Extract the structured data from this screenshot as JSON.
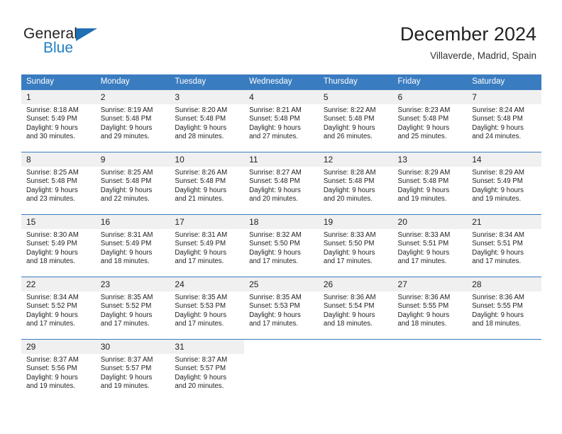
{
  "brand": {
    "name_top": "General",
    "name_bottom": "Blue",
    "triangle_icon": "triangle-icon",
    "color_dark": "#231f20",
    "color_blue": "#1f7ec4"
  },
  "header": {
    "title": "December 2024",
    "subtitle": "Villaverde, Madrid, Spain"
  },
  "theme": {
    "header_bar": "#3a7cc0",
    "daynum_band": "#f0f0f0",
    "text": "#222222"
  },
  "calendar": {
    "weekday_headers": [
      "Sunday",
      "Monday",
      "Tuesday",
      "Wednesday",
      "Thursday",
      "Friday",
      "Saturday"
    ],
    "weeks": [
      [
        {
          "day": "1",
          "sunrise": "Sunrise: 8:18 AM",
          "sunset": "Sunset: 5:49 PM",
          "daylight_1": "Daylight: 9 hours",
          "daylight_2": "and 30 minutes."
        },
        {
          "day": "2",
          "sunrise": "Sunrise: 8:19 AM",
          "sunset": "Sunset: 5:48 PM",
          "daylight_1": "Daylight: 9 hours",
          "daylight_2": "and 29 minutes."
        },
        {
          "day": "3",
          "sunrise": "Sunrise: 8:20 AM",
          "sunset": "Sunset: 5:48 PM",
          "daylight_1": "Daylight: 9 hours",
          "daylight_2": "and 28 minutes."
        },
        {
          "day": "4",
          "sunrise": "Sunrise: 8:21 AM",
          "sunset": "Sunset: 5:48 PM",
          "daylight_1": "Daylight: 9 hours",
          "daylight_2": "and 27 minutes."
        },
        {
          "day": "5",
          "sunrise": "Sunrise: 8:22 AM",
          "sunset": "Sunset: 5:48 PM",
          "daylight_1": "Daylight: 9 hours",
          "daylight_2": "and 26 minutes."
        },
        {
          "day": "6",
          "sunrise": "Sunrise: 8:23 AM",
          "sunset": "Sunset: 5:48 PM",
          "daylight_1": "Daylight: 9 hours",
          "daylight_2": "and 25 minutes."
        },
        {
          "day": "7",
          "sunrise": "Sunrise: 8:24 AM",
          "sunset": "Sunset: 5:48 PM",
          "daylight_1": "Daylight: 9 hours",
          "daylight_2": "and 24 minutes."
        }
      ],
      [
        {
          "day": "8",
          "sunrise": "Sunrise: 8:25 AM",
          "sunset": "Sunset: 5:48 PM",
          "daylight_1": "Daylight: 9 hours",
          "daylight_2": "and 23 minutes."
        },
        {
          "day": "9",
          "sunrise": "Sunrise: 8:25 AM",
          "sunset": "Sunset: 5:48 PM",
          "daylight_1": "Daylight: 9 hours",
          "daylight_2": "and 22 minutes."
        },
        {
          "day": "10",
          "sunrise": "Sunrise: 8:26 AM",
          "sunset": "Sunset: 5:48 PM",
          "daylight_1": "Daylight: 9 hours",
          "daylight_2": "and 21 minutes."
        },
        {
          "day": "11",
          "sunrise": "Sunrise: 8:27 AM",
          "sunset": "Sunset: 5:48 PM",
          "daylight_1": "Daylight: 9 hours",
          "daylight_2": "and 20 minutes."
        },
        {
          "day": "12",
          "sunrise": "Sunrise: 8:28 AM",
          "sunset": "Sunset: 5:48 PM",
          "daylight_1": "Daylight: 9 hours",
          "daylight_2": "and 20 minutes."
        },
        {
          "day": "13",
          "sunrise": "Sunrise: 8:29 AM",
          "sunset": "Sunset: 5:48 PM",
          "daylight_1": "Daylight: 9 hours",
          "daylight_2": "and 19 minutes."
        },
        {
          "day": "14",
          "sunrise": "Sunrise: 8:29 AM",
          "sunset": "Sunset: 5:49 PM",
          "daylight_1": "Daylight: 9 hours",
          "daylight_2": "and 19 minutes."
        }
      ],
      [
        {
          "day": "15",
          "sunrise": "Sunrise: 8:30 AM",
          "sunset": "Sunset: 5:49 PM",
          "daylight_1": "Daylight: 9 hours",
          "daylight_2": "and 18 minutes."
        },
        {
          "day": "16",
          "sunrise": "Sunrise: 8:31 AM",
          "sunset": "Sunset: 5:49 PM",
          "daylight_1": "Daylight: 9 hours",
          "daylight_2": "and 18 minutes."
        },
        {
          "day": "17",
          "sunrise": "Sunrise: 8:31 AM",
          "sunset": "Sunset: 5:49 PM",
          "daylight_1": "Daylight: 9 hours",
          "daylight_2": "and 17 minutes."
        },
        {
          "day": "18",
          "sunrise": "Sunrise: 8:32 AM",
          "sunset": "Sunset: 5:50 PM",
          "daylight_1": "Daylight: 9 hours",
          "daylight_2": "and 17 minutes."
        },
        {
          "day": "19",
          "sunrise": "Sunrise: 8:33 AM",
          "sunset": "Sunset: 5:50 PM",
          "daylight_1": "Daylight: 9 hours",
          "daylight_2": "and 17 minutes."
        },
        {
          "day": "20",
          "sunrise": "Sunrise: 8:33 AM",
          "sunset": "Sunset: 5:51 PM",
          "daylight_1": "Daylight: 9 hours",
          "daylight_2": "and 17 minutes."
        },
        {
          "day": "21",
          "sunrise": "Sunrise: 8:34 AM",
          "sunset": "Sunset: 5:51 PM",
          "daylight_1": "Daylight: 9 hours",
          "daylight_2": "and 17 minutes."
        }
      ],
      [
        {
          "day": "22",
          "sunrise": "Sunrise: 8:34 AM",
          "sunset": "Sunset: 5:52 PM",
          "daylight_1": "Daylight: 9 hours",
          "daylight_2": "and 17 minutes."
        },
        {
          "day": "23",
          "sunrise": "Sunrise: 8:35 AM",
          "sunset": "Sunset: 5:52 PM",
          "daylight_1": "Daylight: 9 hours",
          "daylight_2": "and 17 minutes."
        },
        {
          "day": "24",
          "sunrise": "Sunrise: 8:35 AM",
          "sunset": "Sunset: 5:53 PM",
          "daylight_1": "Daylight: 9 hours",
          "daylight_2": "and 17 minutes."
        },
        {
          "day": "25",
          "sunrise": "Sunrise: 8:35 AM",
          "sunset": "Sunset: 5:53 PM",
          "daylight_1": "Daylight: 9 hours",
          "daylight_2": "and 17 minutes."
        },
        {
          "day": "26",
          "sunrise": "Sunrise: 8:36 AM",
          "sunset": "Sunset: 5:54 PM",
          "daylight_1": "Daylight: 9 hours",
          "daylight_2": "and 18 minutes."
        },
        {
          "day": "27",
          "sunrise": "Sunrise: 8:36 AM",
          "sunset": "Sunset: 5:55 PM",
          "daylight_1": "Daylight: 9 hours",
          "daylight_2": "and 18 minutes."
        },
        {
          "day": "28",
          "sunrise": "Sunrise: 8:36 AM",
          "sunset": "Sunset: 5:55 PM",
          "daylight_1": "Daylight: 9 hours",
          "daylight_2": "and 18 minutes."
        }
      ],
      [
        {
          "day": "29",
          "sunrise": "Sunrise: 8:37 AM",
          "sunset": "Sunset: 5:56 PM",
          "daylight_1": "Daylight: 9 hours",
          "daylight_2": "and 19 minutes."
        },
        {
          "day": "30",
          "sunrise": "Sunrise: 8:37 AM",
          "sunset": "Sunset: 5:57 PM",
          "daylight_1": "Daylight: 9 hours",
          "daylight_2": "and 19 minutes."
        },
        {
          "day": "31",
          "sunrise": "Sunrise: 8:37 AM",
          "sunset": "Sunset: 5:57 PM",
          "daylight_1": "Daylight: 9 hours",
          "daylight_2": "and 20 minutes."
        },
        {
          "day": "",
          "sunrise": "",
          "sunset": "",
          "daylight_1": "",
          "daylight_2": ""
        },
        {
          "day": "",
          "sunrise": "",
          "sunset": "",
          "daylight_1": "",
          "daylight_2": ""
        },
        {
          "day": "",
          "sunrise": "",
          "sunset": "",
          "daylight_1": "",
          "daylight_2": ""
        },
        {
          "day": "",
          "sunrise": "",
          "sunset": "",
          "daylight_1": "",
          "daylight_2": ""
        }
      ]
    ]
  }
}
